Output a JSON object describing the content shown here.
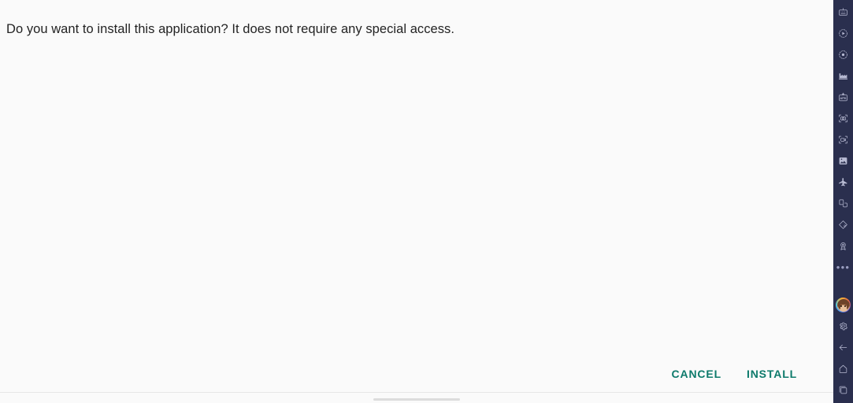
{
  "window": {
    "title": "Android Emulator",
    "background_color": "#fafafa",
    "accent_color": "#0d7a6b",
    "toolbar_color": "#2a2f4e"
  },
  "dialog": {
    "name": "install-application-dialog",
    "message": "Do you want to install this application? It does not require any special access.",
    "buttons": [
      {
        "id": "cancel",
        "label": "CANCEL"
      },
      {
        "id": "install",
        "label": "INSTALL"
      }
    ]
  },
  "navigation_bar": {
    "gesture_pill": ""
  },
  "emulator_toolbar": {
    "top_items": [
      {
        "id": "keyboard",
        "icon": "keyboard-icon",
        "label": "Keyboard input"
      },
      {
        "id": "play",
        "icon": "play-circle-icon",
        "label": "Play"
      },
      {
        "id": "record",
        "icon": "record-circle-icon",
        "label": "Record"
      },
      {
        "id": "factory",
        "icon": "factory-icon",
        "label": "Virtual sensors"
      },
      {
        "id": "apk",
        "icon": "apk-install-icon",
        "label": "Install APK"
      },
      {
        "id": "screenshot",
        "icon": "camera-capture-icon",
        "label": "Take screenshot"
      },
      {
        "id": "screenrecord",
        "icon": "video-capture-icon",
        "label": "Record screen"
      },
      {
        "id": "gallery",
        "icon": "photo-gallery-icon",
        "label": "Gallery"
      },
      {
        "id": "airplane",
        "icon": "airplane-icon",
        "label": "Airplane mode"
      },
      {
        "id": "rotate",
        "icon": "rotate-layout-icon",
        "label": "Rotate"
      },
      {
        "id": "fold",
        "icon": "fold-resize-icon",
        "label": "Fold / resize"
      },
      {
        "id": "location",
        "icon": "location-pin-icon",
        "label": "Location"
      },
      {
        "id": "more",
        "icon": "more-dots-icon",
        "label": "..."
      }
    ],
    "bottom_items": [
      {
        "id": "account",
        "icon": "avatar-icon",
        "label": "Account"
      },
      {
        "id": "settings",
        "icon": "gear-icon",
        "label": "Settings"
      },
      {
        "id": "back",
        "icon": "arrow-back-icon",
        "label": "Back"
      },
      {
        "id": "home",
        "icon": "home-icon",
        "label": "Home"
      },
      {
        "id": "recents",
        "icon": "recent-apps-icon",
        "label": "Recent apps"
      }
    ],
    "more_glyph": "•••"
  }
}
